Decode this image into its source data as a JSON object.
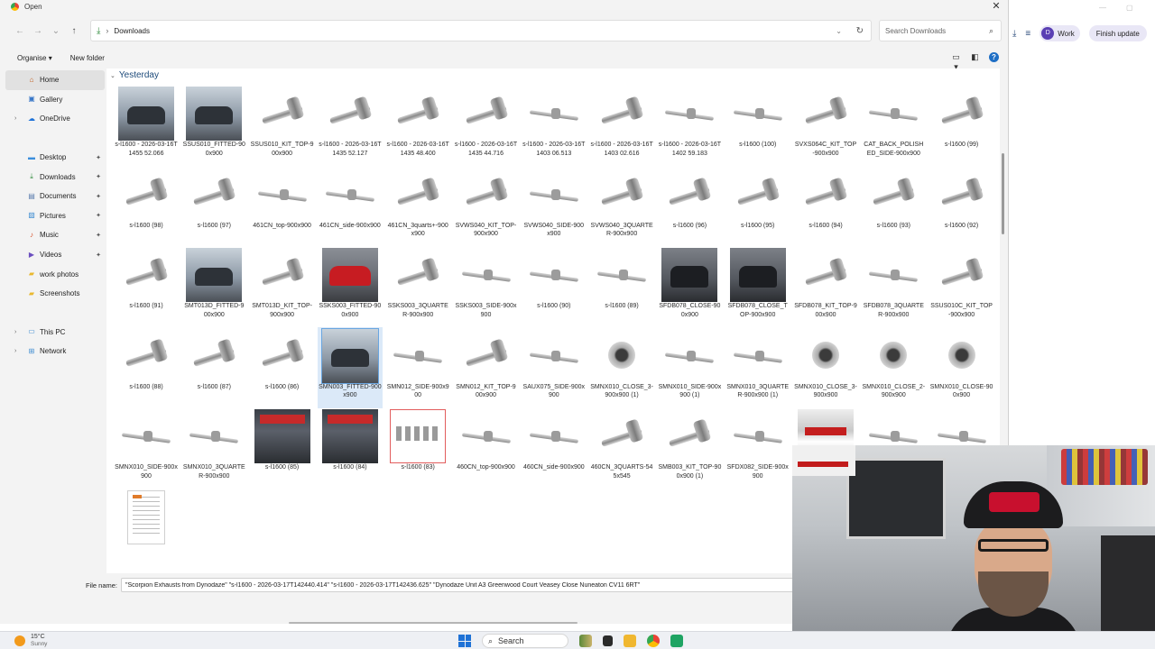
{
  "window": {
    "title": "Open"
  },
  "address": {
    "crumb": "Downloads"
  },
  "search": {
    "placeholder": "Search Downloads"
  },
  "commands": {
    "organise": "Organise",
    "new_folder": "New folder"
  },
  "sidebar": {
    "items": [
      {
        "label": "Home",
        "icon": "home-icon",
        "selected": true
      },
      {
        "label": "Gallery",
        "icon": "gallery-icon"
      },
      {
        "label": "OneDrive",
        "icon": "onedrive-icon",
        "expandable": true
      },
      {
        "label": "Desktop",
        "icon": "desktop-icon",
        "pinned": true
      },
      {
        "label": "Downloads",
        "icon": "downloads-icon",
        "pinned": true
      },
      {
        "label": "Documents",
        "icon": "documents-icon",
        "pinned": true
      },
      {
        "label": "Pictures",
        "icon": "pictures-icon",
        "pinned": true
      },
      {
        "label": "Music",
        "icon": "music-icon",
        "pinned": true
      },
      {
        "label": "Videos",
        "icon": "videos-icon",
        "pinned": true
      },
      {
        "label": "work photos",
        "icon": "folder-icon"
      },
      {
        "label": "Screenshots",
        "icon": "folder-icon"
      },
      {
        "label": "This PC",
        "icon": "pc-icon",
        "expandable": true
      },
      {
        "label": "Network",
        "icon": "network-icon",
        "expandable": true
      }
    ]
  },
  "group": {
    "label": "Yesterday"
  },
  "files": [
    {
      "name": "s-l1600 - 2026-03-16T1455 52.066",
      "thumb": "car"
    },
    {
      "name": "SSUS010_FITTED-900x900",
      "thumb": "car"
    },
    {
      "name": "SSUS010_KIT_TOP-900x900",
      "thumb": "exh"
    },
    {
      "name": "s-l1600 - 2026-03-16T1435 52.127",
      "thumb": "exh"
    },
    {
      "name": "s-l1600 - 2026-03-16T1435 48.400",
      "thumb": "exh"
    },
    {
      "name": "s-l1600 - 2026-03-16T1435 44.716",
      "thumb": "exh"
    },
    {
      "name": "s-l1600 - 2026-03-16T1403 06.513",
      "thumb": "pipe"
    },
    {
      "name": "s-l1600 - 2026-03-16T1403 02.616",
      "thumb": "exh"
    },
    {
      "name": "s-l1600 - 2026-03-16T1402 59.183",
      "thumb": "pipe"
    },
    {
      "name": "s-l1600 (100)",
      "thumb": "pipe"
    },
    {
      "name": "SVXS064C_KIT_TOP-900x900",
      "thumb": "exh"
    },
    {
      "name": "CAT_BACK_POLISHED_SIDE-900x900",
      "thumb": "pipe"
    },
    {
      "name": "s-l1600 (99)",
      "thumb": "exh"
    },
    {
      "name": "s-l1600 (98)",
      "thumb": "exh"
    },
    {
      "name": "s-l1600 (97)",
      "thumb": "exh"
    },
    {
      "name": "461CN_top-900x900",
      "thumb": "pipe"
    },
    {
      "name": "461CN_side-900x900",
      "thumb": "pipe"
    },
    {
      "name": "461CN_3quarts+-900x900",
      "thumb": "exh"
    },
    {
      "name": "SVWS040_KIT_TOP-900x900",
      "thumb": "exh"
    },
    {
      "name": "SVWS040_SIDE-900x900",
      "thumb": "pipe"
    },
    {
      "name": "SVWS040_3QUARTER-900x900",
      "thumb": "exh"
    },
    {
      "name": "s-l1600 (96)",
      "thumb": "exh"
    },
    {
      "name": "s-l1600 (95)",
      "thumb": "exh"
    },
    {
      "name": "s-l1600 (94)",
      "thumb": "exh"
    },
    {
      "name": "s-l1600 (93)",
      "thumb": "exh"
    },
    {
      "name": "s-l1600 (92)",
      "thumb": "exh"
    },
    {
      "name": "s-l1600 (91)",
      "thumb": "exh"
    },
    {
      "name": "SMT013D_FITTED-900x900",
      "thumb": "car"
    },
    {
      "name": "SMT013D_KIT_TOP-900x900",
      "thumb": "exh"
    },
    {
      "name": "SSKS003_FITTED-900x900",
      "thumb": "red"
    },
    {
      "name": "SSKS003_3QUARTER-900x900",
      "thumb": "exh"
    },
    {
      "name": "SSKS003_SIDE-900x900",
      "thumb": "pipe"
    },
    {
      "name": "s-l1600 (90)",
      "thumb": "pipe"
    },
    {
      "name": "s-l1600 (89)",
      "thumb": "pipe"
    },
    {
      "name": "SFDB078_CLOSE-900x900",
      "thumb": "blk"
    },
    {
      "name": "SFDB078_CLOSE_TOP-900x900",
      "thumb": "blk"
    },
    {
      "name": "SFDB078_KIT_TOP-900x900",
      "thumb": "exh"
    },
    {
      "name": "SFDB078_3QUARTER-900x900",
      "thumb": "pipe"
    },
    {
      "name": "SSUS010C_KIT_TOP-900x900",
      "thumb": "exh"
    },
    {
      "name": "s-l1600 (88)",
      "thumb": "exh"
    },
    {
      "name": "s-l1600 (87)",
      "thumb": "exh"
    },
    {
      "name": "s-l1600 (86)",
      "thumb": "exh"
    },
    {
      "name": "SMN003_FITTED-900x900",
      "thumb": "car",
      "selected": true
    },
    {
      "name": "SMN012_SIDE-900x900",
      "thumb": "pipe"
    },
    {
      "name": "SMN012_KIT_TOP-900x900",
      "thumb": "exh"
    },
    {
      "name": "SAUX075_SIDE-900x900",
      "thumb": "pipe"
    },
    {
      "name": "SMNX010_CLOSE_3-900x900 (1)",
      "thumb": "cat"
    },
    {
      "name": "SMNX010_SIDE-900x900 (1)",
      "thumb": "pipe"
    },
    {
      "name": "SMNX010_3QUARTER-900x900 (1)",
      "thumb": "pipe"
    },
    {
      "name": "SMNX010_CLOSE_3-900x900",
      "thumb": "cat"
    },
    {
      "name": "SMNX010_CLOSE_2-900x900",
      "thumb": "cat"
    },
    {
      "name": "SMNX010_CLOSE-900x900",
      "thumb": "cat"
    },
    {
      "name": "SMNX010_SIDE-900x900",
      "thumb": "pipe"
    },
    {
      "name": "SMNX010_3QUARTER-900x900",
      "thumb": "pipe"
    },
    {
      "name": "s-l1600 (85)",
      "thumb": "poster"
    },
    {
      "name": "s-l1600 (84)",
      "thumb": "poster"
    },
    {
      "name": "s-l1600 (83)",
      "thumb": "kit"
    },
    {
      "name": "460CN_top-900x900",
      "thumb": "pipe"
    },
    {
      "name": "460CN_side-900x900",
      "thumb": "pipe"
    },
    {
      "name": "460CN_3QUARTS-545x545",
      "thumb": "exh"
    },
    {
      "name": "SMB003_KIT_TOP-900x900 (1)",
      "thumb": "exh"
    },
    {
      "name": "SFDX082_SIDE-900x900",
      "thumb": "pipe"
    },
    {
      "name": "",
      "thumb": "dyna"
    },
    {
      "name": "",
      "thumb": "pipe"
    },
    {
      "name": "",
      "thumb": "pipe"
    },
    {
      "name": "",
      "thumb": "doc"
    }
  ],
  "filename": {
    "label": "File name:",
    "value": "\"Scorpion Exhausts from Dynodaze\" \"s-l1600 - 2026-03-17T142440.414\" \"s-l1600 - 2026-03-17T142436.625\" \"Dynodaze Unit A3 Greenwood Court Veasey Close Nuneaton CV11 6RT\""
  },
  "browser": {
    "profile_initial": "D",
    "profile_label": "Work",
    "update_label": "Finish update"
  },
  "taskbar": {
    "temp": "15°C",
    "condition": "Sunny",
    "search_label": "Search"
  },
  "colors": {
    "accent": "#1f72d6",
    "selected": "#dbe9f8",
    "profile": "#5a3fb3"
  }
}
